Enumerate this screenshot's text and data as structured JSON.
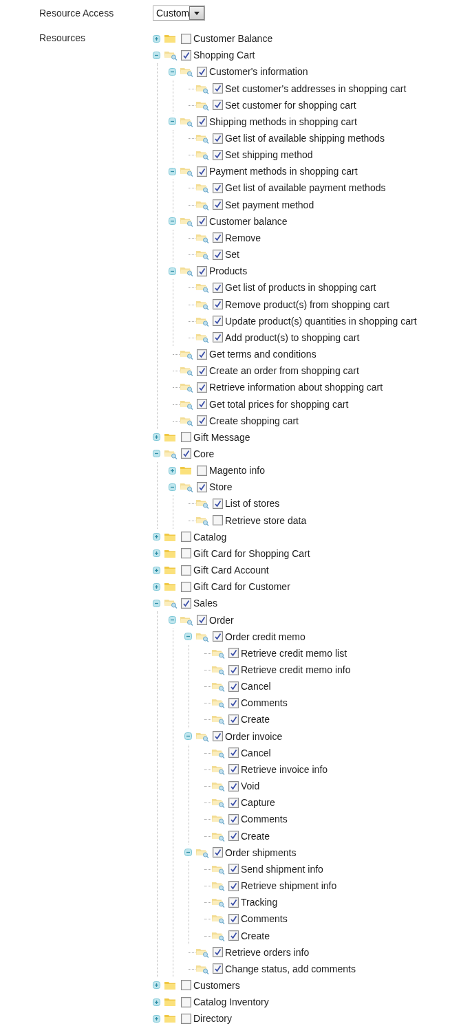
{
  "resource_access": {
    "label": "Resource Access",
    "value": "Custom"
  },
  "resources": {
    "label": "Resources",
    "tree": [
      {
        "label": "Customer Balance",
        "checked": false,
        "expanded": false
      },
      {
        "label": "Shopping Cart",
        "checked": true,
        "expanded": true,
        "children": [
          {
            "label": "Customer's information",
            "checked": true,
            "expanded": true,
            "children": [
              {
                "label": "Set customer's addresses in shopping cart",
                "checked": true
              },
              {
                "label": "Set customer for shopping cart",
                "checked": true
              }
            ]
          },
          {
            "label": "Shipping methods in shopping cart",
            "checked": true,
            "expanded": true,
            "children": [
              {
                "label": "Get list of available shipping methods",
                "checked": true
              },
              {
                "label": "Set shipping method",
                "checked": true
              }
            ]
          },
          {
            "label": "Payment methods in shopping cart",
            "checked": true,
            "expanded": true,
            "children": [
              {
                "label": "Get list of available payment methods",
                "checked": true
              },
              {
                "label": "Set payment method",
                "checked": true
              }
            ]
          },
          {
            "label": "Customer balance",
            "checked": true,
            "expanded": true,
            "children": [
              {
                "label": "Remove",
                "checked": true
              },
              {
                "label": "Set",
                "checked": true
              }
            ]
          },
          {
            "label": "Products",
            "checked": true,
            "expanded": true,
            "children": [
              {
                "label": "Get list of products in shopping cart",
                "checked": true
              },
              {
                "label": "Remove product(s) from shopping cart",
                "checked": true
              },
              {
                "label": "Update product(s) quantities in shopping cart",
                "checked": true
              },
              {
                "label": "Add product(s) to shopping cart",
                "checked": true
              }
            ]
          },
          {
            "label": "Get terms and conditions",
            "checked": true
          },
          {
            "label": "Create an order from shopping cart",
            "checked": true
          },
          {
            "label": "Retrieve information about shopping cart",
            "checked": true
          },
          {
            "label": "Get total prices for shopping cart",
            "checked": true
          },
          {
            "label": "Create shopping cart",
            "checked": true
          }
        ]
      },
      {
        "label": "Gift Message",
        "checked": false,
        "expanded": false
      },
      {
        "label": "Core",
        "checked": true,
        "expanded": true,
        "children": [
          {
            "label": "Magento info",
            "checked": false,
            "expanded": false
          },
          {
            "label": "Store",
            "checked": true,
            "expanded": true,
            "children": [
              {
                "label": "List of stores",
                "checked": true
              },
              {
                "label": "Retrieve store data",
                "checked": false
              }
            ]
          }
        ]
      },
      {
        "label": "Catalog",
        "checked": false,
        "expanded": false
      },
      {
        "label": "Gift Card for Shopping Cart",
        "checked": false,
        "expanded": false
      },
      {
        "label": "Gift Card Account",
        "checked": false,
        "expanded": false
      },
      {
        "label": "Gift Card for Customer",
        "checked": false,
        "expanded": false
      },
      {
        "label": "Sales",
        "checked": true,
        "expanded": true,
        "children": [
          {
            "label": "Order",
            "checked": true,
            "expanded": true,
            "children": [
              {
                "label": "Order credit memo",
                "checked": true,
                "expanded": true,
                "children": [
                  {
                    "label": "Retrieve credit memo list",
                    "checked": true
                  },
                  {
                    "label": "Retrieve credit memo info",
                    "checked": true
                  },
                  {
                    "label": "Cancel",
                    "checked": true
                  },
                  {
                    "label": "Comments",
                    "checked": true
                  },
                  {
                    "label": "Create",
                    "checked": true
                  }
                ]
              },
              {
                "label": "Order invoice",
                "checked": true,
                "expanded": true,
                "children": [
                  {
                    "label": "Cancel",
                    "checked": true
                  },
                  {
                    "label": "Retrieve invoice info",
                    "checked": true
                  },
                  {
                    "label": "Void",
                    "checked": true
                  },
                  {
                    "label": "Capture",
                    "checked": true
                  },
                  {
                    "label": "Comments",
                    "checked": true
                  },
                  {
                    "label": "Create",
                    "checked": true
                  }
                ]
              },
              {
                "label": "Order shipments",
                "checked": true,
                "expanded": true,
                "children": [
                  {
                    "label": "Send shipment info",
                    "checked": true
                  },
                  {
                    "label": "Retrieve shipment info",
                    "checked": true
                  },
                  {
                    "label": "Tracking",
                    "checked": true
                  },
                  {
                    "label": "Comments",
                    "checked": true
                  },
                  {
                    "label": "Create",
                    "checked": true
                  }
                ]
              },
              {
                "label": "Retrieve orders info",
                "checked": true
              },
              {
                "label": "Change status, add comments",
                "checked": true
              }
            ]
          }
        ]
      },
      {
        "label": "Customers",
        "checked": false,
        "expanded": false
      },
      {
        "label": "Catalog Inventory",
        "checked": false,
        "expanded": false
      },
      {
        "label": "Directory",
        "checked": false,
        "expanded": false
      }
    ]
  }
}
